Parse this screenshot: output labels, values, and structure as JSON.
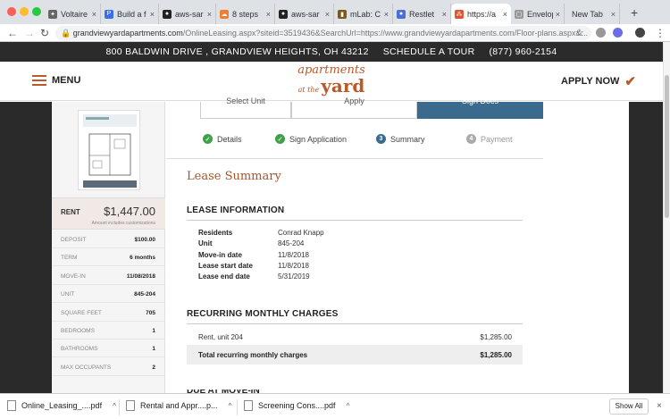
{
  "browser": {
    "tabs": [
      {
        "title": "Voltaire",
        "color": "#666666",
        "glyph": "✦"
      },
      {
        "title": "Build a f",
        "color": "#3b6ee8",
        "glyph": "P"
      },
      {
        "title": "aws-sar",
        "color": "#222222",
        "glyph": "●"
      },
      {
        "title": "8 steps",
        "color": "#f07e30",
        "glyph": "☁"
      },
      {
        "title": "aws-sar",
        "color": "#222222",
        "glyph": "●"
      },
      {
        "title": "mLab: C",
        "color": "#7a5a1c",
        "glyph": "▮"
      },
      {
        "title": "Restlet",
        "color": "#4e6ed6",
        "glyph": "●"
      },
      {
        "title": "https://a",
        "color": "#e0532f",
        "glyph": "⁂"
      },
      {
        "title": "Envelop",
        "color": "#999999",
        "glyph": "▢"
      },
      {
        "title": "New Tab",
        "color": "#ffffff",
        "glyph": ""
      }
    ],
    "tab_close": "×",
    "new_tab": "+",
    "url_main": "grandviewyardapartments.com",
    "url_rest": "/OnlineLeasing.aspx?siteid=3519436&SearchUrl=https://www.grandviewyardapartments.com/Floor-plans.aspx&..."
  },
  "site": {
    "address": "800 BALDWIN DRIVE , GRANDVIEW HEIGHTS, OH 43212",
    "schedule": "SCHEDULE A TOUR",
    "phone": "(877) 960-2154",
    "menu_label": "MENU",
    "logo_line1": "apartments",
    "logo_at": "at the",
    "logo_line2": "yard",
    "apply_label": "APPLY NOW",
    "accent": "#b85a2a"
  },
  "steps_top": {
    "select_unit": "Select Unit",
    "apply": "Apply",
    "sign_docs": "Sign Docs"
  },
  "progress": [
    {
      "label": "Details",
      "marker": "✓",
      "color": "#3fa04a"
    },
    {
      "label": "Sign Application",
      "marker": "✓",
      "color": "#3fa04a"
    },
    {
      "label": "Summary",
      "marker": "3",
      "color": "#3b6a8f"
    },
    {
      "label": "Payment",
      "marker": "4",
      "color": "#aaaaaa"
    }
  ],
  "sidebar": {
    "rent_label": "RENT",
    "rent_amount": "$1,447.00",
    "rent_note": "Amount includes customizations",
    "rows": [
      {
        "label": "DEPOSIT",
        "value": "$100.00"
      },
      {
        "label": "TERM",
        "value": "6 months"
      },
      {
        "label": "MOVE-IN",
        "value": "11/08/2018"
      },
      {
        "label": "UNIT",
        "value": "845-204"
      },
      {
        "label": "SQUARE FEET",
        "value": "705"
      },
      {
        "label": "BEDROOMS",
        "value": "1"
      },
      {
        "label": "BATHROOMS",
        "value": "1"
      },
      {
        "label": "MAX OCCUPANTS",
        "value": "2"
      }
    ]
  },
  "lease": {
    "title": "Lease Summary",
    "info_heading": "LEASE INFORMATION",
    "info": [
      {
        "label": "Residents",
        "value": "Conrad Knapp"
      },
      {
        "label": "Unit",
        "value": "845-204"
      },
      {
        "label": "Move-in date",
        "value": "11/8/2018"
      },
      {
        "label": "Lease start date",
        "value": "11/8/2018"
      },
      {
        "label": "Lease end date",
        "value": "5/31/2019"
      }
    ],
    "charges_heading": "RECURRING MONTHLY CHARGES",
    "charge_label": "Rent, unit 204",
    "charge_value": "$1,285.00",
    "total_label": "Total recurring monthly charges",
    "total_value": "$1,285.00",
    "next_heading": "DUE AT MOVE-IN"
  },
  "downloads": {
    "items": [
      "Online_Leasing_....pdf",
      "Rental and Appr....p...",
      "Screening Cons....pdf"
    ],
    "show_all": "Show All",
    "close": "×"
  }
}
